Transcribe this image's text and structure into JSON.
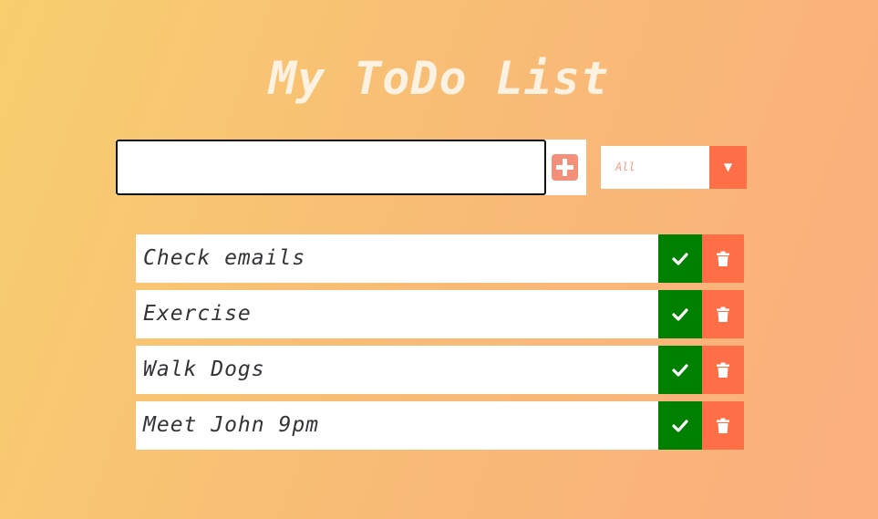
{
  "header": {
    "title": "My ToDo List"
  },
  "form": {
    "input_value": "",
    "input_placeholder": "",
    "add_icon": "plus-square-icon"
  },
  "filter": {
    "selected": "All",
    "arrow_icon": "triangle-down-icon"
  },
  "todos": [
    {
      "text": "Check emails",
      "check_icon": "check-icon",
      "trash_icon": "trash-icon"
    },
    {
      "text": "Exercise",
      "check_icon": "check-icon",
      "trash_icon": "trash-icon"
    },
    {
      "text": "Walk Dogs",
      "check_icon": "check-icon",
      "trash_icon": "trash-icon"
    },
    {
      "text": "Meet John 9pm",
      "check_icon": "check-icon",
      "trash_icon": "trash-icon"
    }
  ],
  "colors": {
    "complete": "#008000",
    "delete": "#ff6f47",
    "accent": "#f4907a"
  }
}
